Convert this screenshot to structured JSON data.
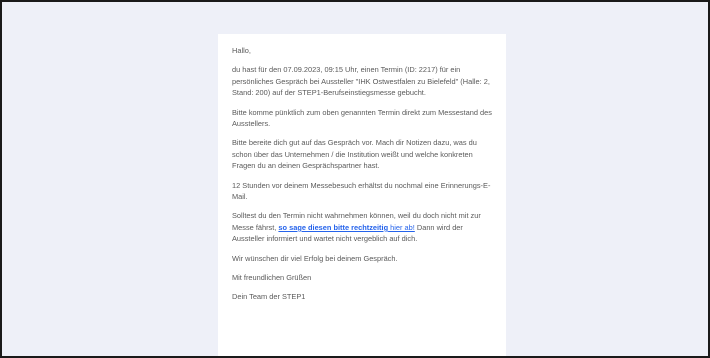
{
  "email": {
    "greeting": "Hallo,",
    "para1": "du hast für den 07.09.2023, 09:15 Uhr, einen Termin (ID: 2217) für ein persönliches Gespräch bei Aussteller \"IHK Ostwestfalen zu Bielefeld\" (Halle: 2, Stand: 200) auf der STEP1-Berufseinstiegsmesse gebucht.",
    "para2": "Bitte komme pünktlich zum oben genannten Termin direkt zum Messestand des Ausstellers.",
    "para3": "Bitte bereite dich gut auf das Gespräch vor. Mach dir Notizen dazu, was du schon über das Unternehmen / die Institution weißt und welche konkreten Fragen du an deinen Gesprächspartner hast.",
    "para4": "12 Stunden vor deinem Messebesuch erhältst du nochmal eine Erinnerungs-E-Mail.",
    "para5_before": "Solltest du den Termin nicht wahrnehmen können, weil du doch nicht mit zur Messe fährst, ",
    "para5_link_bold": "so sage diesen bitte rechtzeitig",
    "para5_link_tail": " hier ab!",
    "para5_after": " Dann wird der Aussteller informiert und wartet nicht vergeblich auf dich.",
    "para6": "Wir wünschen dir viel Erfolg bei deinem Gespräch.",
    "closing": "Mit freundlichen Grüßen",
    "signature": "Dein Team der STEP1"
  },
  "colors": {
    "page_background": "#eef0f8",
    "card_background": "#ffffff",
    "body_text": "#5a5a5a",
    "link": "#2563eb"
  }
}
